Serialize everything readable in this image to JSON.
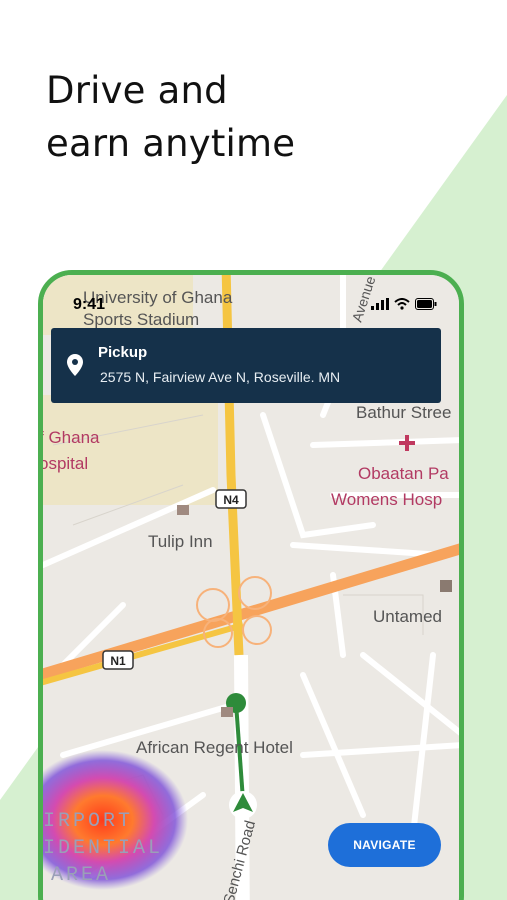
{
  "headline": {
    "line1": "Drive and",
    "line2": "earn anytime"
  },
  "status_bar": {
    "time": "9:41"
  },
  "pickup": {
    "title": "Pickup",
    "address": "2575 N, Fairview Ave N, Roseville. MN"
  },
  "map_labels": {
    "stadium_line1": "University of Ghana",
    "stadium_line2": "Sports Stadium",
    "hospital_line1": "f Ghana",
    "hospital_line2": "ospital",
    "avenue": "Avenue",
    "bathur": "Bathur Stree",
    "obaatan_line1": "Obaatan Pa",
    "obaatan_line2": "Womens Hosp",
    "tulip": "Tulip Inn",
    "untamed": "Untamed",
    "african_regent": "African Regent Hotel",
    "senchi": "Senchi Road",
    "airport_line1": "IRPORT",
    "airport_line2": "IDENTIAL",
    "airport_line3": "AREA",
    "n4": "N4",
    "n1": "N1"
  },
  "navigate_button": {
    "label": "NAVIGATE"
  },
  "colors": {
    "accent_green": "#4caf50",
    "card_navy": "#15314a",
    "button_blue": "#1e6fd9",
    "route_green": "#2e8b3a",
    "highway_yellow": "#f5c542",
    "highway_orange": "#f7a35c"
  }
}
